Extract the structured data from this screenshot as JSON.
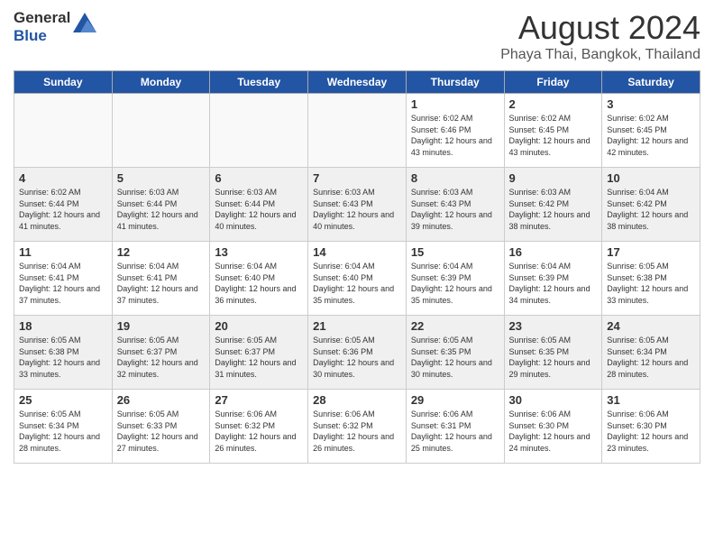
{
  "header": {
    "logo_line1": "General",
    "logo_line2": "Blue",
    "month_year": "August 2024",
    "location": "Phaya Thai, Bangkok, Thailand"
  },
  "days_of_week": [
    "Sunday",
    "Monday",
    "Tuesday",
    "Wednesday",
    "Thursday",
    "Friday",
    "Saturday"
  ],
  "weeks": [
    [
      {
        "num": "",
        "empty": true
      },
      {
        "num": "",
        "empty": true
      },
      {
        "num": "",
        "empty": true
      },
      {
        "num": "",
        "empty": true
      },
      {
        "num": "1",
        "sunrise": "6:02 AM",
        "sunset": "6:46 PM",
        "daylight": "12 hours and 43 minutes."
      },
      {
        "num": "2",
        "sunrise": "6:02 AM",
        "sunset": "6:45 PM",
        "daylight": "12 hours and 43 minutes."
      },
      {
        "num": "3",
        "sunrise": "6:02 AM",
        "sunset": "6:45 PM",
        "daylight": "12 hours and 42 minutes."
      }
    ],
    [
      {
        "num": "4",
        "sunrise": "6:02 AM",
        "sunset": "6:44 PM",
        "daylight": "12 hours and 41 minutes."
      },
      {
        "num": "5",
        "sunrise": "6:03 AM",
        "sunset": "6:44 PM",
        "daylight": "12 hours and 41 minutes."
      },
      {
        "num": "6",
        "sunrise": "6:03 AM",
        "sunset": "6:44 PM",
        "daylight": "12 hours and 40 minutes."
      },
      {
        "num": "7",
        "sunrise": "6:03 AM",
        "sunset": "6:43 PM",
        "daylight": "12 hours and 40 minutes."
      },
      {
        "num": "8",
        "sunrise": "6:03 AM",
        "sunset": "6:43 PM",
        "daylight": "12 hours and 39 minutes."
      },
      {
        "num": "9",
        "sunrise": "6:03 AM",
        "sunset": "6:42 PM",
        "daylight": "12 hours and 38 minutes."
      },
      {
        "num": "10",
        "sunrise": "6:04 AM",
        "sunset": "6:42 PM",
        "daylight": "12 hours and 38 minutes."
      }
    ],
    [
      {
        "num": "11",
        "sunrise": "6:04 AM",
        "sunset": "6:41 PM",
        "daylight": "12 hours and 37 minutes."
      },
      {
        "num": "12",
        "sunrise": "6:04 AM",
        "sunset": "6:41 PM",
        "daylight": "12 hours and 37 minutes."
      },
      {
        "num": "13",
        "sunrise": "6:04 AM",
        "sunset": "6:40 PM",
        "daylight": "12 hours and 36 minutes."
      },
      {
        "num": "14",
        "sunrise": "6:04 AM",
        "sunset": "6:40 PM",
        "daylight": "12 hours and 35 minutes."
      },
      {
        "num": "15",
        "sunrise": "6:04 AM",
        "sunset": "6:39 PM",
        "daylight": "12 hours and 35 minutes."
      },
      {
        "num": "16",
        "sunrise": "6:04 AM",
        "sunset": "6:39 PM",
        "daylight": "12 hours and 34 minutes."
      },
      {
        "num": "17",
        "sunrise": "6:05 AM",
        "sunset": "6:38 PM",
        "daylight": "12 hours and 33 minutes."
      }
    ],
    [
      {
        "num": "18",
        "sunrise": "6:05 AM",
        "sunset": "6:38 PM",
        "daylight": "12 hours and 33 minutes."
      },
      {
        "num": "19",
        "sunrise": "6:05 AM",
        "sunset": "6:37 PM",
        "daylight": "12 hours and 32 minutes."
      },
      {
        "num": "20",
        "sunrise": "6:05 AM",
        "sunset": "6:37 PM",
        "daylight": "12 hours and 31 minutes."
      },
      {
        "num": "21",
        "sunrise": "6:05 AM",
        "sunset": "6:36 PM",
        "daylight": "12 hours and 30 minutes."
      },
      {
        "num": "22",
        "sunrise": "6:05 AM",
        "sunset": "6:35 PM",
        "daylight": "12 hours and 30 minutes."
      },
      {
        "num": "23",
        "sunrise": "6:05 AM",
        "sunset": "6:35 PM",
        "daylight": "12 hours and 29 minutes."
      },
      {
        "num": "24",
        "sunrise": "6:05 AM",
        "sunset": "6:34 PM",
        "daylight": "12 hours and 28 minutes."
      }
    ],
    [
      {
        "num": "25",
        "sunrise": "6:05 AM",
        "sunset": "6:34 PM",
        "daylight": "12 hours and 28 minutes."
      },
      {
        "num": "26",
        "sunrise": "6:05 AM",
        "sunset": "6:33 PM",
        "daylight": "12 hours and 27 minutes."
      },
      {
        "num": "27",
        "sunrise": "6:06 AM",
        "sunset": "6:32 PM",
        "daylight": "12 hours and 26 minutes."
      },
      {
        "num": "28",
        "sunrise": "6:06 AM",
        "sunset": "6:32 PM",
        "daylight": "12 hours and 26 minutes."
      },
      {
        "num": "29",
        "sunrise": "6:06 AM",
        "sunset": "6:31 PM",
        "daylight": "12 hours and 25 minutes."
      },
      {
        "num": "30",
        "sunrise": "6:06 AM",
        "sunset": "6:30 PM",
        "daylight": "12 hours and 24 minutes."
      },
      {
        "num": "31",
        "sunrise": "6:06 AM",
        "sunset": "6:30 PM",
        "daylight": "12 hours and 23 minutes."
      }
    ]
  ]
}
